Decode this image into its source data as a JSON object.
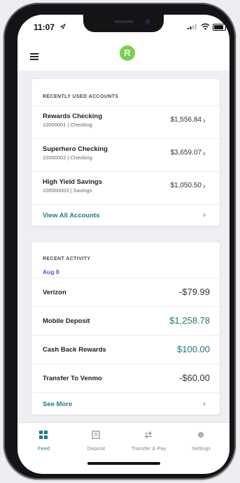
{
  "status": {
    "time": "11:07"
  },
  "topbar": {
    "logo_letter": "R"
  },
  "accounts": {
    "title": "RECENTLY USED ACCOUNTS",
    "items": [
      {
        "name": "Rewards Checking",
        "sub": "10000001 | Checking",
        "balance": "$1,556.84"
      },
      {
        "name": "Superhero Checking",
        "sub": "10000002 | Checking",
        "balance": "$3,659.07"
      },
      {
        "name": "High Yield Savings",
        "sub": "100000003 | Savings",
        "balance": "$1,050.50"
      }
    ],
    "view_all": "View All Accounts"
  },
  "activity": {
    "title": "RECENT ACTIVITY",
    "date": "Aug 8",
    "items": [
      {
        "name": "Verizon",
        "amount": "-$79.99",
        "positive": false
      },
      {
        "name": "Mobile Deposit",
        "amount": "$1,258.78",
        "positive": true
      },
      {
        "name": "Cash Back Rewards",
        "amount": "$100.00",
        "positive": true
      },
      {
        "name": "Transfer To Venmo",
        "amount": "-$60.00",
        "positive": false
      }
    ],
    "see_more": "See More"
  },
  "tabs": [
    {
      "label": "Feed",
      "icon": "feed-icon",
      "active": true
    },
    {
      "label": "Deposit",
      "icon": "deposit-icon",
      "active": false
    },
    {
      "label": "Transfer & Pay",
      "icon": "transfer-icon",
      "active": false
    },
    {
      "label": "Settings",
      "icon": "gear-icon",
      "active": false
    }
  ],
  "colors": {
    "accent": "#1f7a8c",
    "positive": "#1f7a6e",
    "date": "#7b3fe0",
    "logo": "#7bd04b"
  }
}
